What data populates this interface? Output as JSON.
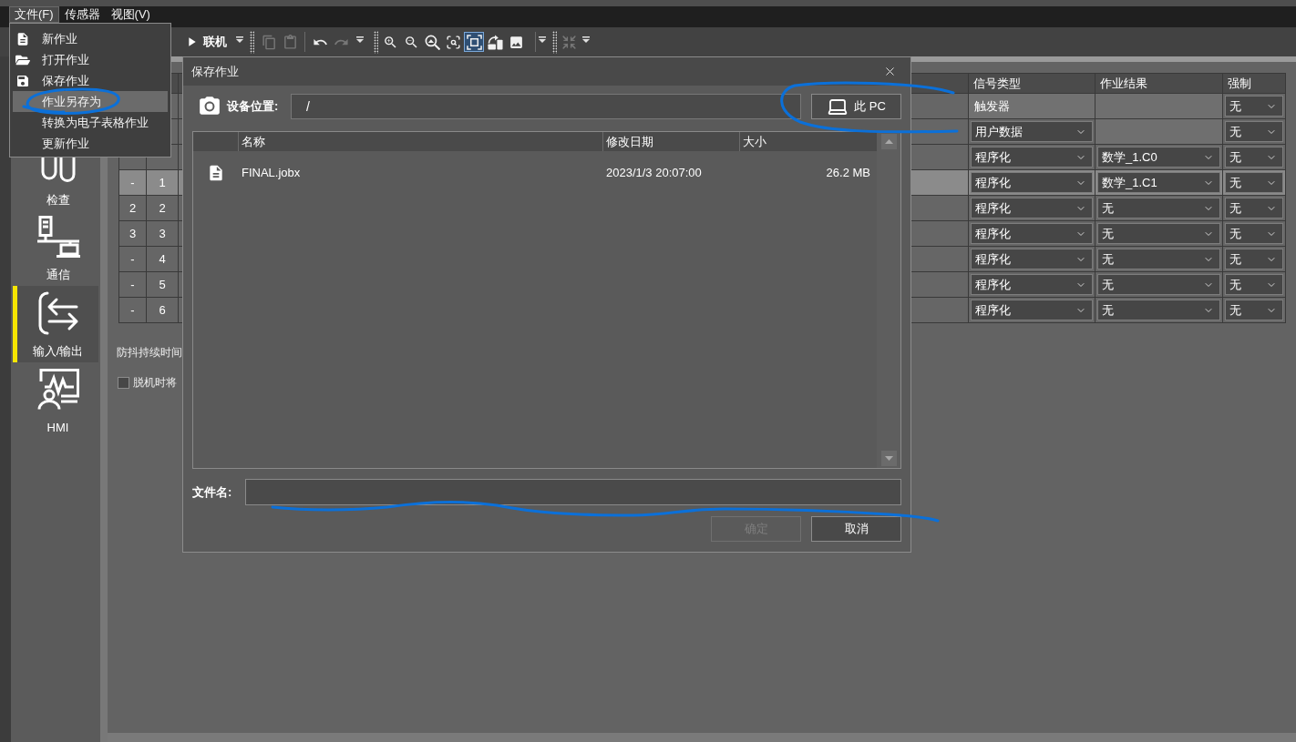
{
  "menu_bar": {
    "items": [
      {
        "label": "文件(F)",
        "selected": true
      },
      {
        "label": "传感器",
        "selected": false
      },
      {
        "label": "视图(V)",
        "selected": false
      }
    ]
  },
  "file_menu": {
    "items": [
      {
        "label": "新作业",
        "selected": false,
        "circled": false
      },
      {
        "label": "打开作业",
        "selected": false,
        "circled": false
      },
      {
        "label": "保存作业",
        "selected": false,
        "circled": false
      },
      {
        "label": "作业另存为",
        "selected": true,
        "circled": true
      },
      {
        "label": "转换为电子表格作业",
        "selected": false,
        "circled": false
      },
      {
        "label": "更新作业",
        "selected": false,
        "circled": false
      }
    ]
  },
  "toolbar": {
    "run_button": {
      "label": "联机"
    },
    "tool_groups": [
      {
        "tools": [
          {
            "disabled": true,
            "selected": false
          },
          {
            "disabled": true,
            "selected": false
          }
        ]
      },
      {
        "tools": [
          {
            "disabled": false,
            "selected": false
          },
          {
            "disabled": true,
            "selected": false
          }
        ]
      },
      {
        "tools": [
          {
            "disabled": false,
            "selected": false
          },
          {
            "disabled": false,
            "selected": false
          },
          {
            "disabled": false,
            "selected": false
          },
          {
            "disabled": false,
            "selected": false
          },
          {
            "disabled": false,
            "selected": true
          },
          {
            "disabled": false,
            "selected": false
          },
          {
            "disabled": false,
            "selected": false
          }
        ]
      },
      {
        "tools": [
          {
            "disabled": true,
            "selected": false
          }
        ]
      }
    ]
  },
  "sidebar": {
    "items": [
      {
        "label": "检查",
        "selected": false
      },
      {
        "label": "通信",
        "selected": false
      },
      {
        "label": "输入/输出",
        "selected": true
      },
      {
        "label": "HMI",
        "selected": false
      }
    ]
  },
  "io_table": {
    "columns": [
      "信号类型",
      "作业结果",
      "强制"
    ],
    "rows": [
      {
        "selected": false,
        "signal_type": {
          "kind": "text",
          "value": "触发器"
        },
        "job_result": {
          "kind": "empty"
        },
        "force": {
          "kind": "dropdown",
          "value": "无"
        }
      },
      {
        "selected": false,
        "signal_type": {
          "kind": "dropdown",
          "value": "用户数据"
        },
        "job_result": {
          "kind": "empty"
        },
        "force": {
          "kind": "dropdown",
          "value": "无"
        }
      },
      {
        "selected": false,
        "signal_type": {
          "kind": "dropdown",
          "value": "程序化"
        },
        "job_result": {
          "kind": "dropdown",
          "value": "数学_1.C0"
        },
        "force": {
          "kind": "dropdown",
          "value": "无"
        }
      },
      {
        "col_1": "-",
        "col_2": "1",
        "selected": true,
        "signal_type": {
          "kind": "dropdown",
          "value": "程序化"
        },
        "job_result": {
          "kind": "dropdown",
          "value": "数学_1.C1"
        },
        "force": {
          "kind": "dropdown",
          "value": "无"
        }
      },
      {
        "col_1": "2",
        "col_2": "2",
        "selected": false,
        "signal_type": {
          "kind": "dropdown",
          "value": "程序化"
        },
        "job_result": {
          "kind": "dropdown",
          "value": "无"
        },
        "force": {
          "kind": "dropdown",
          "value": "无"
        }
      },
      {
        "col_1": "3",
        "col_2": "3",
        "selected": false,
        "signal_type": {
          "kind": "dropdown",
          "value": "程序化"
        },
        "job_result": {
          "kind": "dropdown",
          "value": "无"
        },
        "force": {
          "kind": "dropdown",
          "value": "无"
        }
      },
      {
        "col_1": "-",
        "col_2": "4",
        "selected": false,
        "signal_type": {
          "kind": "dropdown",
          "value": "程序化"
        },
        "job_result": {
          "kind": "dropdown",
          "value": "无"
        },
        "force": {
          "kind": "dropdown",
          "value": "无"
        }
      },
      {
        "col_1": "-",
        "col_2": "5",
        "selected": false,
        "signal_type": {
          "kind": "dropdown",
          "value": "程序化"
        },
        "job_result": {
          "kind": "dropdown",
          "value": "无"
        },
        "force": {
          "kind": "dropdown",
          "value": "无"
        }
      },
      {
        "col_1": "-",
        "col_2": "6",
        "selected": false,
        "signal_type": {
          "kind": "dropdown",
          "value": "程序化"
        },
        "job_result": {
          "kind": "dropdown",
          "value": "无"
        },
        "force": {
          "kind": "dropdown",
          "value": "无"
        }
      }
    ]
  },
  "debounce_label": "防抖持续时间",
  "offline_option": {
    "label": "脱机时将",
    "checked": false
  },
  "save_dialog": {
    "title": "保存作业",
    "location": {
      "label": "设备位置:",
      "value": "/"
    },
    "pc_button": {
      "label": "此 PC",
      "circled": true
    },
    "file_list": {
      "columns": [
        "名称",
        "修改日期",
        "大小"
      ],
      "rows": [
        {
          "name": "FINAL.jobx",
          "modified": "2023/1/3 20:07:00",
          "size": "26.2 MB"
        }
      ]
    },
    "filename": {
      "label": "文件名:",
      "underlined": true
    },
    "buttons": [
      {
        "label": "确定",
        "disabled": true
      },
      {
        "label": "取消",
        "disabled": false
      }
    ]
  }
}
